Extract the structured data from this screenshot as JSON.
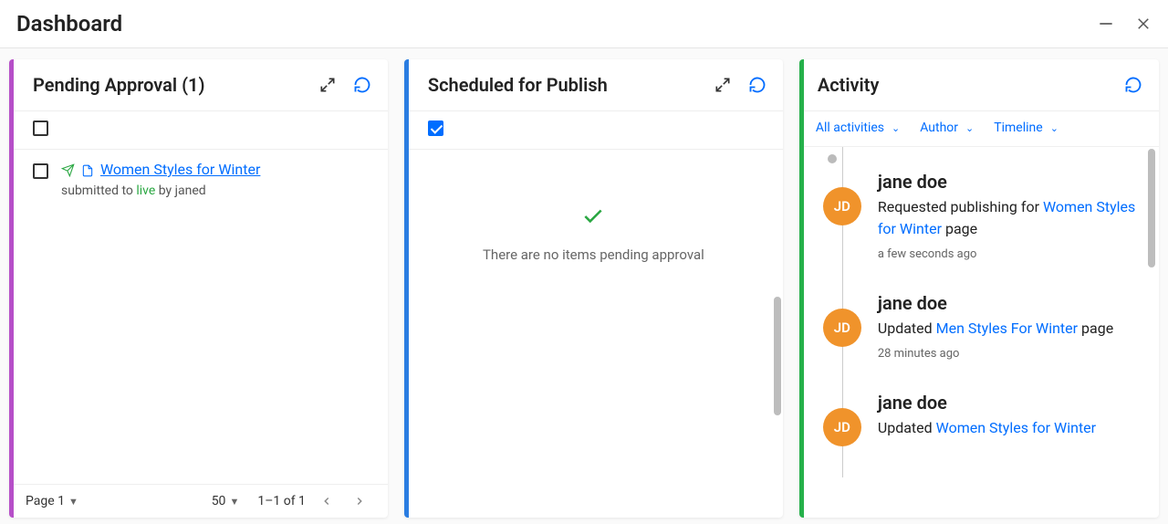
{
  "header": {
    "title": "Dashboard"
  },
  "pending": {
    "title": "Pending Approval (1)",
    "item": {
      "title": "Women Styles for Winter",
      "submitted_prefix": "submitted to ",
      "live": "live",
      "by": " by janed"
    },
    "footer": {
      "page": "Page 1",
      "page_size": "50",
      "range": "1–1 of 1"
    }
  },
  "scheduled": {
    "title": "Scheduled for Publish",
    "empty": "There are no items pending approval"
  },
  "activity": {
    "title": "Activity",
    "filters": {
      "all": "All activities",
      "author": "Author",
      "timeline": "Timeline"
    },
    "items": [
      {
        "avatar": "JD",
        "name": "jane doe",
        "desc_prefix": "Requested publishing for ",
        "link": "Women Styles for Winter",
        "desc_suffix": " page",
        "time": "a few seconds ago"
      },
      {
        "avatar": "JD",
        "name": "jane doe",
        "desc_prefix": "Updated ",
        "link": "Men Styles For Winter",
        "desc_suffix": " page",
        "time": "28 minutes ago"
      },
      {
        "avatar": "JD",
        "name": "jane doe",
        "desc_prefix": "Updated ",
        "link": "Women Styles for Winter",
        "desc_suffix": "",
        "time": ""
      }
    ]
  }
}
